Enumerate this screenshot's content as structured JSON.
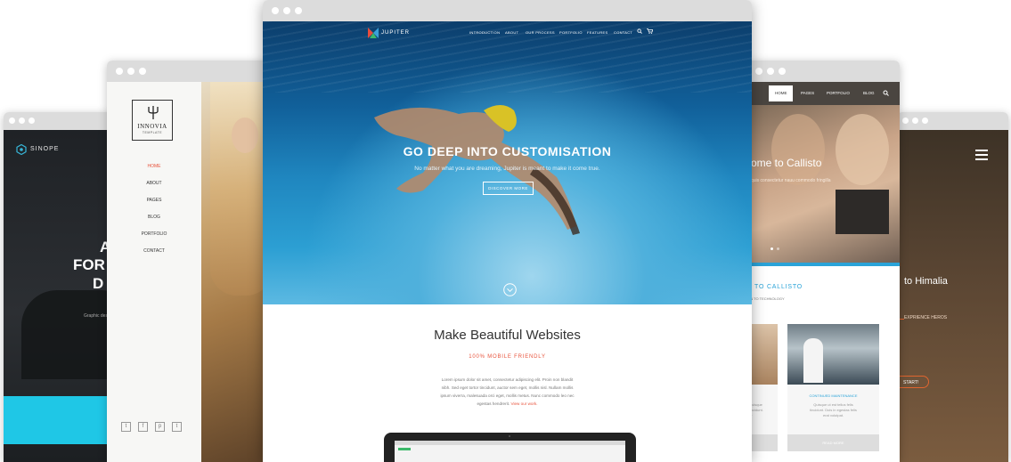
{
  "sinope": {
    "logo": "SINOPE",
    "headline_lines": [
      "A",
      "FOR",
      "D"
    ],
    "caption": "Graphic des"
  },
  "innovia": {
    "logo_name": "INNOVIA",
    "logo_sub": "TEMPLATE",
    "menu": [
      "HOME",
      "ABOUT",
      "PAGES",
      "BLOG",
      "PORTFOLIO",
      "CONTACT"
    ],
    "social_icons": [
      "twitter-icon",
      "facebook-icon",
      "pinterest-icon",
      "tumblr-icon"
    ],
    "social_glyphs": [
      "t",
      "f",
      "p",
      "t"
    ]
  },
  "jupiter": {
    "logo": "JUPITER",
    "nav": [
      "INTRODUCTION",
      "ABOUT",
      "OUR PROCESS",
      "PORTFOLIO",
      "FEATURES",
      "CONTACT"
    ],
    "hero_title": "GO DEEP INTO CUSTOMISATION",
    "hero_sub": "No matter what you are dreaming, Jupiter is meant to make it come true.",
    "hero_button": "DISCOVER MORE",
    "section_title": "Make Beautiful Websites",
    "section_sub": "100% MOBILE FRIENDLY",
    "paragraph_lines": [
      "Lorem ipsum dolor sit amet, consectetur adipiscing elit. Proin non blandit",
      "nibh. Sed eget tortor tincidunt, auctor sem eget, mollis nisl. Nullam mollis",
      "ipsum viverra, malesuada orci eget, mollis metus. Nunc commodo leo nec",
      "egestas hendrerit."
    ],
    "paragraph_link": "View our work."
  },
  "callisto": {
    "nav": [
      "HOME",
      "PAGES",
      "PORTFOLIO",
      "BLOG"
    ],
    "hero_title": "ome to Callisto",
    "hero_sub": "quis consectetur nauu commodo fringilla",
    "section_title": "TO CALLISTO",
    "section_sub": "ION TO TECHNOLOGY",
    "card_title": "CONTINUED MAINTENANCE",
    "card_text_lines": [
      "Quisque ut est tellus felis",
      "tincidunt. Duis in egestas felis",
      "erat volutpat."
    ],
    "card_text_left": [
      "Quisque",
      "lincidunt.",
      "er"
    ],
    "card_button": "READ MORE"
  },
  "himalia": {
    "hero_title": "to Himalia",
    "hero_sub": "EXPRIENCE HEROS",
    "button": "START!"
  },
  "colors": {
    "accent_red": "#e8553e",
    "callisto_blue": "#2aa3d8",
    "sinope_cyan": "#1fc7e6",
    "himalia_orange": "#e0652f"
  }
}
